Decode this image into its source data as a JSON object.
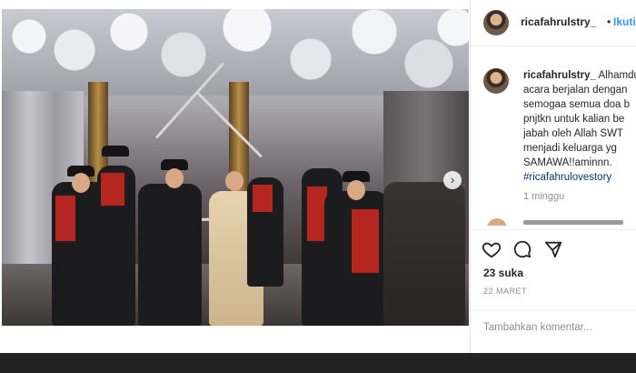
{
  "post": {
    "photo_alt": "",
    "next_arrow": "›"
  },
  "header": {
    "username": "ricafahrulstry_",
    "separator": "•",
    "follow_label": "Ikuti"
  },
  "caption": {
    "username": "ricafahrulstry_",
    "lines": [
      "Alhamdulillah",
      "acara berjalan dengan",
      "semogaa semua doa b",
      "pnjtkn untuk kalian be",
      "jabah oleh Allah SWT",
      "menjadi keluarga yg",
      "SAMAWA!!aminnn."
    ],
    "hashtag": "#ricafahrulovestory",
    "time_ago": "1 minggu"
  },
  "actions": {
    "like_icon": "heart-icon",
    "comment_icon": "comment-icon",
    "share_icon": "share-icon",
    "likes_text": "23 suka",
    "date_text": "22 MARET"
  },
  "comment": {
    "placeholder": "Tambahkan komentar..."
  },
  "colors": {
    "accent_blue": "#3897f0",
    "hashtag": "#00376b",
    "muted": "#8e8e8e",
    "text": "#262626"
  }
}
